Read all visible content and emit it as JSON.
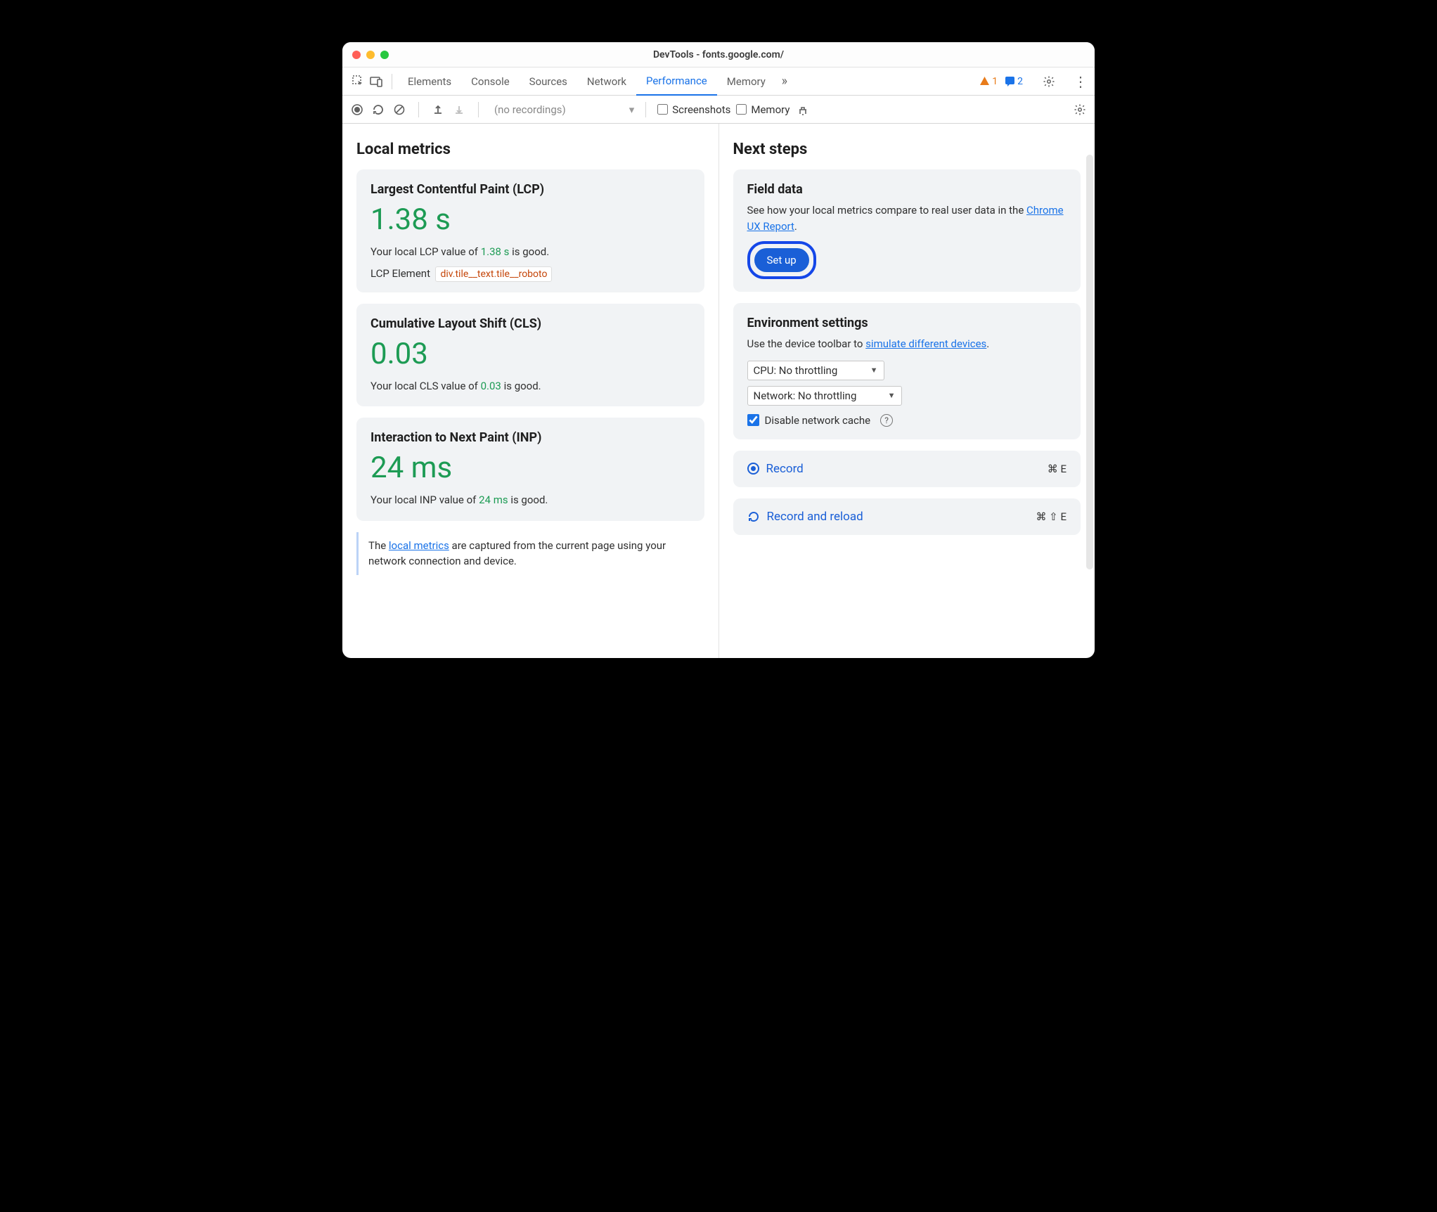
{
  "window": {
    "title": "DevTools - fonts.google.com/"
  },
  "tabs": {
    "items": [
      "Elements",
      "Console",
      "Sources",
      "Network",
      "Performance",
      "Memory"
    ],
    "active": "Performance",
    "warnings": "1",
    "infos": "2"
  },
  "toolbar": {
    "dropdown": "(no recordings)",
    "screenshots_label": "Screenshots",
    "memory_label": "Memory"
  },
  "local": {
    "heading": "Local metrics",
    "lcp": {
      "title": "Largest Contentful Paint (LCP)",
      "value": "1.38 s",
      "desc_pre": "Your local LCP value of ",
      "desc_val": "1.38 s",
      "desc_post": " is good.",
      "el_label": "LCP Element",
      "el_chip": "div.tile__text.tile__roboto"
    },
    "cls": {
      "title": "Cumulative Layout Shift (CLS)",
      "value": "0.03",
      "desc_pre": "Your local CLS value of ",
      "desc_val": "0.03",
      "desc_post": " is good."
    },
    "inp": {
      "title": "Interaction to Next Paint (INP)",
      "value": "24 ms",
      "desc_pre": "Your local INP value of ",
      "desc_val": "24 ms",
      "desc_post": " is good."
    },
    "note_pre": "The ",
    "note_link": "local metrics",
    "note_post": " are captured from the current page using your network connection and device."
  },
  "next": {
    "heading": "Next steps",
    "field": {
      "title": "Field data",
      "desc_pre": "See how your local metrics compare to real user data in the ",
      "desc_link": "Chrome UX Report",
      "desc_post": ".",
      "button": "Set up"
    },
    "env": {
      "title": "Environment settings",
      "desc_pre": "Use the device toolbar to ",
      "desc_link": "simulate different devices",
      "desc_post": ".",
      "cpu": "CPU: No throttling",
      "network": "Network: No throttling",
      "disable_cache": "Disable network cache"
    },
    "record": {
      "label": "Record",
      "shortcut": "⌘ E"
    },
    "reload": {
      "label": "Record and reload",
      "shortcut": "⌘ ⇧ E"
    }
  }
}
